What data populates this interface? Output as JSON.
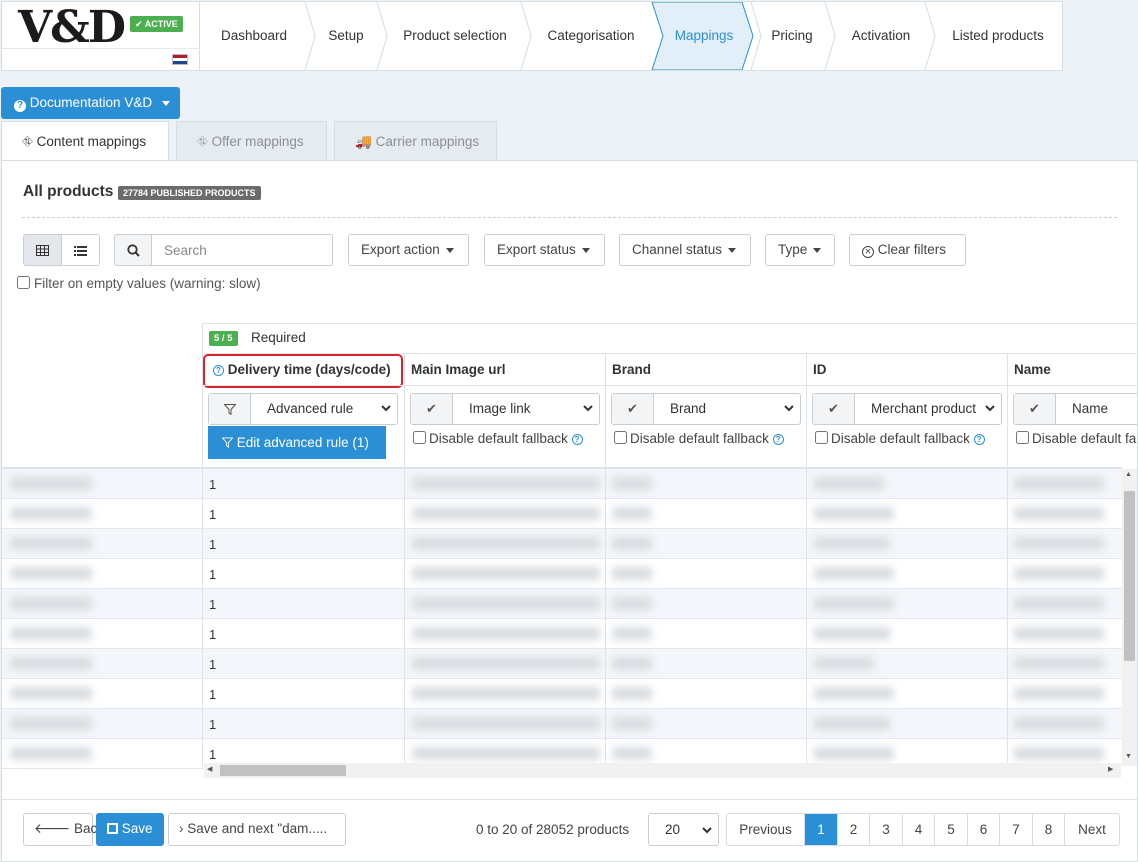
{
  "header": {
    "logo": "V&D",
    "status_badge": "✔ ACTIVE",
    "steps": [
      "Dashboard",
      "Setup",
      "Product selection",
      "Categorisation",
      "Mappings",
      "Pricing",
      "Activation",
      "Listed products"
    ],
    "active_step": "Mappings"
  },
  "documentation_button": "Documentation V&D",
  "tabs": [
    {
      "label": "Content mappings",
      "active": true
    },
    {
      "label": "Offer mappings",
      "active": false
    },
    {
      "label": "Carrier mappings",
      "active": false
    }
  ],
  "panel": {
    "title": "All products",
    "published_badge": "27784 PUBLISHED PRODUCTS",
    "search_placeholder": "Search",
    "filters": [
      "Export action",
      "Export status",
      "Channel status",
      "Type"
    ],
    "clear_filters": "Clear filters",
    "filter_empty_label": "Filter on empty values (warning: slow)"
  },
  "grid": {
    "required_badge": "5 / 5",
    "required_label": "Required",
    "columns": [
      {
        "title": "Delivery time (days/code)",
        "has_help": true,
        "select": "Advanced rule",
        "addon": "filter",
        "edit_button": "Edit advanced rule (1)"
      },
      {
        "title": "Main Image url",
        "select": "Image link",
        "addon": "check",
        "fallback": "Disable default fallback"
      },
      {
        "title": "Brand",
        "select": "Brand",
        "addon": "check",
        "fallback": "Disable default fallback"
      },
      {
        "title": "ID",
        "select": "Merchant product",
        "addon": "check",
        "fallback": "Disable default fallback"
      },
      {
        "title": "Name",
        "select": "Name",
        "addon": "check",
        "fallback": "Disable default fa"
      }
    ],
    "row_values": [
      "1",
      "1",
      "1",
      "1",
      "1",
      "1",
      "1",
      "1",
      "1",
      "1"
    ]
  },
  "footer": {
    "back": "Back",
    "save": "Save",
    "save_next": "Save and next \"dam.....",
    "range_text": "0 to 20 of 28052 products",
    "page_size": "20",
    "previous": "Previous",
    "pages": [
      "1",
      "2",
      "3",
      "4",
      "5",
      "6",
      "7",
      "8"
    ],
    "current_page": "1",
    "next": "Next"
  },
  "colors": {
    "primary": "#2a8fd4",
    "success": "#4caf50",
    "highlight": "#d9232f"
  }
}
